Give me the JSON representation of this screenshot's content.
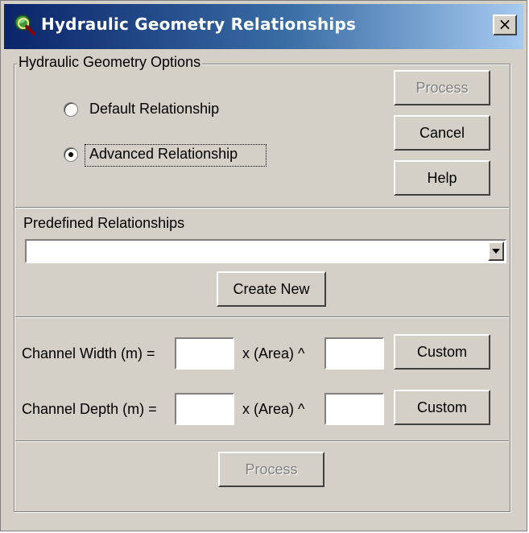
{
  "window": {
    "title": "Hydraulic Geometry Relationships",
    "close_label": "×",
    "app_icon": "globe-magnifier-icon"
  },
  "options_group": {
    "label": "Hydraulic Geometry Options",
    "default_label": "Default Relationship",
    "advanced_label": "Advanced Relationship",
    "selected": "advanced"
  },
  "buttons": {
    "process_top": "Process",
    "cancel": "Cancel",
    "help": "Help",
    "create_new": "Create New",
    "custom_width": "Custom",
    "custom_depth": "Custom",
    "process_bottom": "Process"
  },
  "predefined": {
    "label": "Predefined Relationships",
    "selected_value": ""
  },
  "width_row": {
    "label": "Channel Width (m) =",
    "middle_label": "x (Area) ^",
    "coefficient": "",
    "exponent": ""
  },
  "depth_row": {
    "label": "Channel Depth (m) =",
    "middle_label": "x (Area) ^",
    "coefficient": "",
    "exponent": ""
  },
  "colors": {
    "face": "#d4d0c8",
    "title_start": "#0a246a",
    "title_end": "#a6caf0",
    "disabled_text": "#808080"
  }
}
